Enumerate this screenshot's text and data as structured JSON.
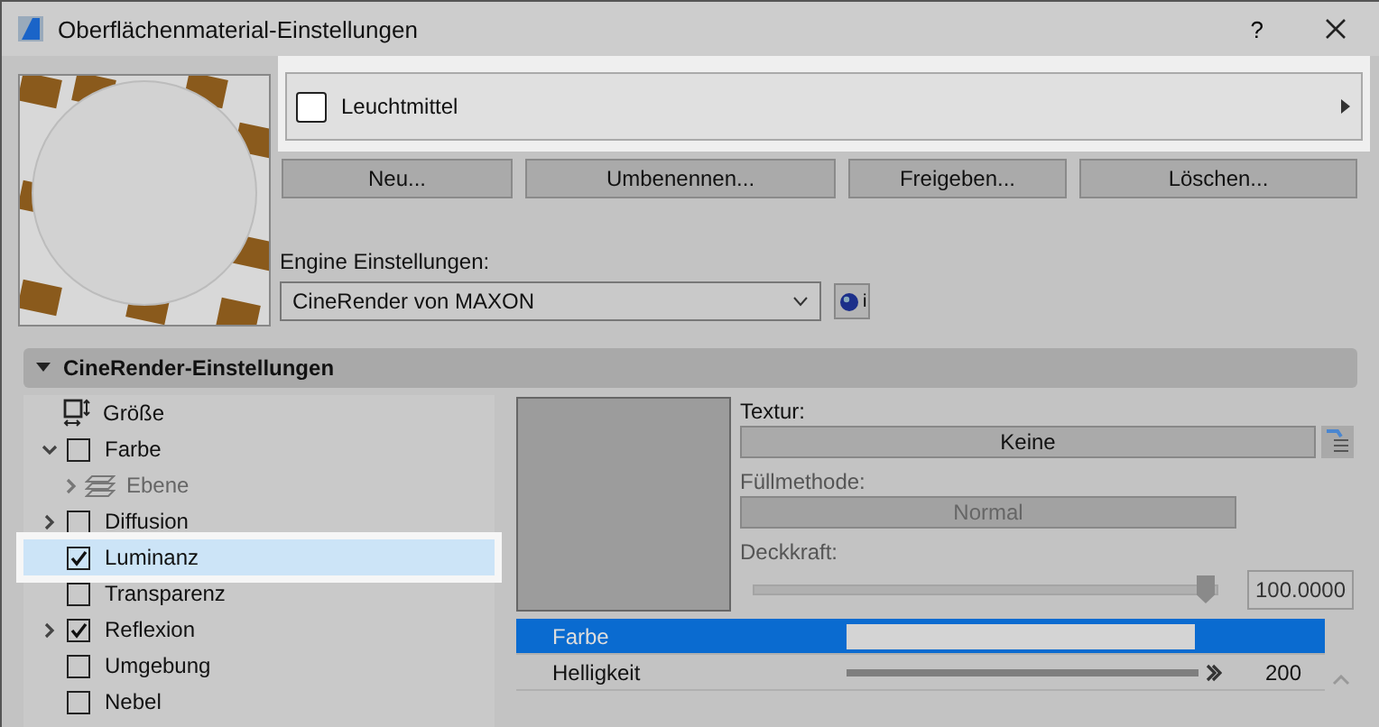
{
  "window": {
    "title": "Oberflächenmaterial-Einstellungen",
    "help": "?"
  },
  "material": {
    "name": "Leuchtmittel"
  },
  "buttons": [
    "Neu...",
    "Umbenennen...",
    "Freigeben...",
    "Löschen..."
  ],
  "engine": {
    "label": "Engine Einstellungen:",
    "value": "CineRender von MAXON",
    "info": "i"
  },
  "section": {
    "title": "CineRender-Einstellungen",
    "expanded": true
  },
  "channels": [
    {
      "kind": "size",
      "label": "Größe",
      "selected": false
    },
    {
      "kind": "channel",
      "label": "Farbe",
      "checked": false,
      "expanded": true,
      "selected": false,
      "children": [
        {
          "kind": "layer",
          "label": "Ebene",
          "disabled": true,
          "expanded": false,
          "selected": false
        }
      ]
    },
    {
      "kind": "channel",
      "label": "Diffusion",
      "checked": false,
      "expanded": false,
      "selected": false
    },
    {
      "kind": "channel",
      "label": "Luminanz",
      "checked": true,
      "selected": true
    },
    {
      "kind": "channel",
      "label": "Transparenz",
      "checked": false,
      "selected": false
    },
    {
      "kind": "channel",
      "label": "Reflexion",
      "checked": true,
      "expanded": false,
      "selected": false
    },
    {
      "kind": "channel",
      "label": "Umgebung",
      "checked": false,
      "selected": false
    },
    {
      "kind": "channel",
      "label": "Nebel",
      "checked": false,
      "selected": false
    }
  ],
  "texture": {
    "label": "Textur:",
    "value": "Keine"
  },
  "fill_method": {
    "label": "Füllmethode:",
    "value": "Normal",
    "disabled": true
  },
  "opacity": {
    "label": "Deckkraft:",
    "level": 1,
    "value": "100.0000"
  },
  "params": [
    {
      "kind": "color",
      "name": "Farbe",
      "color": "#d4d4d4",
      "selected": true
    },
    {
      "kind": "slider",
      "name": "Helligkeit",
      "level": 1,
      "value": "200",
      "selected": false
    }
  ]
}
